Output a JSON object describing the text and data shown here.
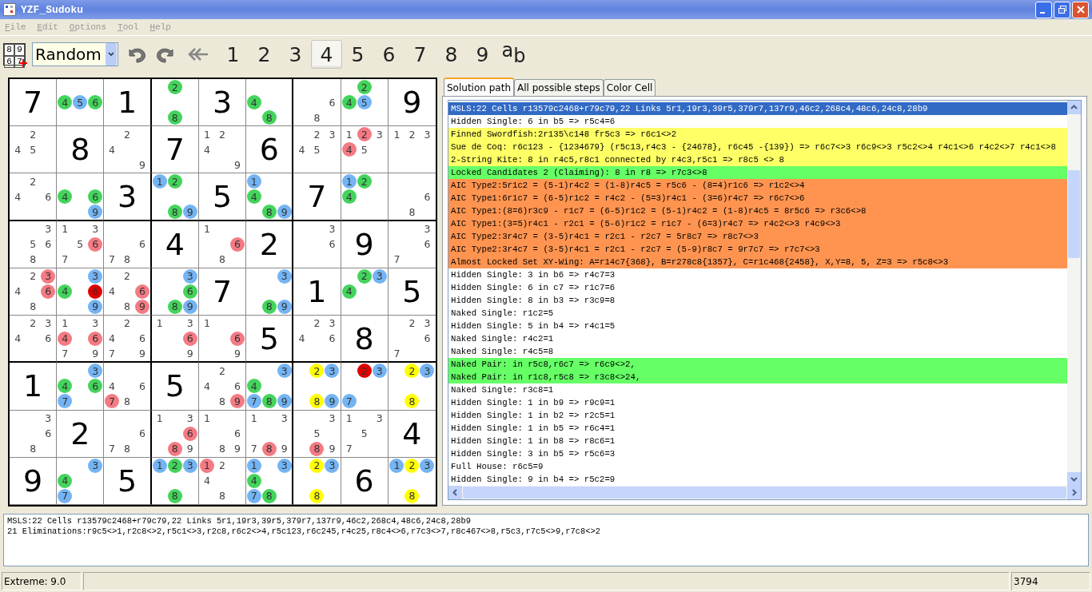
{
  "window": {
    "title": "YZF_Sudoku"
  },
  "menu": [
    "File",
    "Edit",
    "Options",
    "Tool",
    "Help"
  ],
  "toolbar": {
    "new_icon_digits": [
      "8",
      "9",
      "6",
      "7"
    ],
    "mode": "Random",
    "digits": [
      {
        "label": "1",
        "selected": false
      },
      {
        "label": "2",
        "selected": false
      },
      {
        "label": "3",
        "selected": false
      },
      {
        "label": "4",
        "selected": true
      },
      {
        "label": "5",
        "selected": false
      },
      {
        "label": "6",
        "selected": false
      },
      {
        "label": "7",
        "selected": false
      },
      {
        "label": "8",
        "selected": false
      },
      {
        "label": "9",
        "selected": false
      }
    ],
    "notation": {
      "upper": "a",
      "lower": "b"
    }
  },
  "board": {
    "rows": [
      [
        {
          "kind": "given",
          "value": "7"
        },
        {
          "kind": "candidates",
          "candidates": [
            {
              "digit": "4",
              "color": "#44d45c"
            },
            {
              "digit": "5",
              "color": "#74b4f4"
            },
            {
              "digit": "6",
              "color": "#44d45c"
            }
          ]
        },
        {
          "kind": "given",
          "value": "1"
        },
        {
          "kind": "candidates",
          "candidates": [
            {
              "digit": "2",
              "color": "#44d45c"
            },
            {
              "digit": "8",
              "color": "#44d45c"
            }
          ]
        },
        {
          "kind": "given",
          "value": "3"
        },
        {
          "kind": "candidates",
          "candidates": [
            {
              "digit": "4",
              "color": "#44d45c"
            },
            {
              "digit": "8",
              "color": "#44d45c"
            }
          ]
        },
        {
          "kind": "candidates",
          "candidates": [
            {
              "digit": "6"
            },
            {
              "digit": "8"
            }
          ]
        },
        {
          "kind": "candidates",
          "candidates": [
            {
              "digit": "2",
              "color": "#44d45c"
            },
            {
              "digit": "4",
              "color": "#44d45c"
            },
            {
              "digit": "5",
              "color": "#74b4f4"
            }
          ]
        },
        {
          "kind": "given",
          "value": "9"
        }
      ],
      [
        {
          "kind": "candidates",
          "candidates": [
            {
              "digit": "2"
            },
            {
              "digit": "4"
            },
            {
              "digit": "5"
            }
          ]
        },
        {
          "kind": "given",
          "value": "8"
        },
        {
          "kind": "candidates",
          "candidates": [
            {
              "digit": "2"
            },
            {
              "digit": "4"
            },
            {
              "digit": "9"
            }
          ]
        },
        {
          "kind": "given",
          "value": "7"
        },
        {
          "kind": "candidates",
          "candidates": [
            {
              "digit": "1"
            },
            {
              "digit": "2"
            },
            {
              "digit": "4"
            },
            {
              "digit": "9"
            }
          ]
        },
        {
          "kind": "given",
          "value": "6"
        },
        {
          "kind": "candidates",
          "candidates": [
            {
              "digit": "2"
            },
            {
              "digit": "3"
            },
            {
              "digit": "4"
            },
            {
              "digit": "5"
            }
          ]
        },
        {
          "kind": "candidates",
          "candidates": [
            {
              "digit": "1"
            },
            {
              "digit": "2",
              "color": "#f47a84"
            },
            {
              "digit": "3"
            },
            {
              "digit": "4",
              "color": "#f47a84"
            },
            {
              "digit": "5"
            }
          ]
        },
        {
          "kind": "candidates",
          "candidates": [
            {
              "digit": "1"
            },
            {
              "digit": "2"
            },
            {
              "digit": "3"
            }
          ]
        }
      ],
      [
        {
          "kind": "candidates",
          "candidates": [
            {
              "digit": "2"
            },
            {
              "digit": "4"
            },
            {
              "digit": "6"
            }
          ]
        },
        {
          "kind": "candidates",
          "candidates": [
            {
              "digit": "4",
              "color": "#44d45c"
            },
            {
              "digit": "6",
              "color": "#44d45c"
            },
            {
              "digit": "9",
              "color": "#74b4f4"
            }
          ]
        },
        {
          "kind": "given",
          "value": "3"
        },
        {
          "kind": "candidates",
          "candidates": [
            {
              "digit": "1",
              "color": "#74b4f4"
            },
            {
              "digit": "2",
              "color": "#44d45c"
            },
            {
              "digit": "8",
              "color": "#44d45c"
            },
            {
              "digit": "9",
              "color": "#74b4f4"
            }
          ]
        },
        {
          "kind": "given",
          "value": "5"
        },
        {
          "kind": "candidates",
          "candidates": [
            {
              "digit": "1",
              "color": "#74b4f4"
            },
            {
              "digit": "4",
              "color": "#44d45c"
            },
            {
              "digit": "8",
              "color": "#44d45c"
            },
            {
              "digit": "9",
              "color": "#74b4f4"
            }
          ]
        },
        {
          "kind": "given",
          "value": "7"
        },
        {
          "kind": "candidates",
          "candidates": [
            {
              "digit": "1",
              "color": "#74b4f4"
            },
            {
              "digit": "2",
              "color": "#44d45c"
            },
            {
              "digit": "4",
              "color": "#44d45c"
            }
          ]
        },
        {
          "kind": "candidates",
          "candidates": [
            {
              "digit": "6"
            },
            {
              "digit": "8"
            }
          ]
        }
      ],
      [
        {
          "kind": "candidates",
          "candidates": [
            {
              "digit": "3"
            },
            {
              "digit": "5"
            },
            {
              "digit": "6"
            },
            {
              "digit": "8"
            }
          ]
        },
        {
          "kind": "candidates",
          "candidates": [
            {
              "digit": "1"
            },
            {
              "digit": "3"
            },
            {
              "digit": "5"
            },
            {
              "digit": "6",
              "color": "#f47a84"
            },
            {
              "digit": "7"
            }
          ]
        },
        {
          "kind": "candidates",
          "candidates": [
            {
              "digit": "6"
            },
            {
              "digit": "7"
            },
            {
              "digit": "8"
            }
          ]
        },
        {
          "kind": "given",
          "value": "4"
        },
        {
          "kind": "candidates",
          "candidates": [
            {
              "digit": "1"
            },
            {
              "digit": "6",
              "color": "#f47a84"
            },
            {
              "digit": "8"
            }
          ]
        },
        {
          "kind": "given",
          "value": "2"
        },
        {
          "kind": "candidates",
          "candidates": [
            {
              "digit": "3"
            },
            {
              "digit": "6"
            }
          ]
        },
        {
          "kind": "given",
          "value": "9"
        },
        {
          "kind": "candidates",
          "candidates": [
            {
              "digit": "3"
            },
            {
              "digit": "6"
            },
            {
              "digit": "7"
            }
          ]
        }
      ],
      [
        {
          "kind": "candidates",
          "candidates": [
            {
              "digit": "2"
            },
            {
              "digit": "3",
              "color": "#f47a84"
            },
            {
              "digit": "4"
            },
            {
              "digit": "6",
              "color": "#f47a84"
            },
            {
              "digit": "8"
            }
          ]
        },
        {
          "kind": "candidates",
          "candidates": [
            {
              "digit": "3",
              "color": "#74b4f4"
            },
            {
              "digit": "4",
              "color": "#44d45c"
            },
            {
              "digit": "6",
              "color": "#e00000"
            },
            {
              "digit": "9",
              "color": "#74b4f4"
            }
          ]
        },
        {
          "kind": "candidates",
          "candidates": [
            {
              "digit": "2"
            },
            {
              "digit": "4"
            },
            {
              "digit": "6",
              "color": "#f47a84"
            },
            {
              "digit": "8"
            },
            {
              "digit": "9",
              "color": "#f47a84"
            }
          ]
        },
        {
          "kind": "candidates",
          "candidates": [
            {
              "digit": "3",
              "color": "#74b4f4"
            },
            {
              "digit": "6",
              "color": "#44d45c"
            },
            {
              "digit": "8",
              "color": "#44d45c"
            },
            {
              "digit": "9",
              "color": "#74b4f4"
            }
          ]
        },
        {
          "kind": "given",
          "value": "7"
        },
        {
          "kind": "candidates",
          "candidates": [
            {
              "digit": "3",
              "color": "#74b4f4"
            },
            {
              "digit": "8",
              "color": "#44d45c"
            },
            {
              "digit": "9",
              "color": "#74b4f4"
            }
          ]
        },
        {
          "kind": "given",
          "value": "1"
        },
        {
          "kind": "candidates",
          "candidates": [
            {
              "digit": "2",
              "color": "#44d45c"
            },
            {
              "digit": "3",
              "color": "#74b4f4"
            },
            {
              "digit": "4",
              "color": "#44d45c"
            }
          ]
        },
        {
          "kind": "given",
          "value": "5"
        }
      ],
      [
        {
          "kind": "candidates",
          "candidates": [
            {
              "digit": "2"
            },
            {
              "digit": "3"
            },
            {
              "digit": "4"
            },
            {
              "digit": "6"
            }
          ]
        },
        {
          "kind": "candidates",
          "candidates": [
            {
              "digit": "1"
            },
            {
              "digit": "3"
            },
            {
              "digit": "4",
              "color": "#f47a84"
            },
            {
              "digit": "6",
              "color": "#f47a84"
            },
            {
              "digit": "7"
            },
            {
              "digit": "9"
            }
          ]
        },
        {
          "kind": "candidates",
          "candidates": [
            {
              "digit": "2"
            },
            {
              "digit": "4"
            },
            {
              "digit": "6"
            },
            {
              "digit": "7"
            },
            {
              "digit": "9"
            }
          ]
        },
        {
          "kind": "candidates",
          "candidates": [
            {
              "digit": "1"
            },
            {
              "digit": "3"
            },
            {
              "digit": "6",
              "color": "#f47a84"
            },
            {
              "digit": "9"
            }
          ]
        },
        {
          "kind": "candidates",
          "candidates": [
            {
              "digit": "1"
            },
            {
              "digit": "6",
              "color": "#f47a84"
            },
            {
              "digit": "9"
            }
          ]
        },
        {
          "kind": "given",
          "value": "5"
        },
        {
          "kind": "candidates",
          "candidates": [
            {
              "digit": "2"
            },
            {
              "digit": "3"
            },
            {
              "digit": "4"
            },
            {
              "digit": "6"
            }
          ]
        },
        {
          "kind": "given",
          "value": "8"
        },
        {
          "kind": "candidates",
          "candidates": [
            {
              "digit": "2"
            },
            {
              "digit": "3"
            },
            {
              "digit": "6"
            },
            {
              "digit": "7"
            }
          ]
        }
      ],
      [
        {
          "kind": "given",
          "value": "1"
        },
        {
          "kind": "candidates",
          "candidates": [
            {
              "digit": "3",
              "color": "#74b4f4"
            },
            {
              "digit": "4",
              "color": "#44d45c"
            },
            {
              "digit": "6",
              "color": "#44d45c"
            },
            {
              "digit": "7",
              "color": "#74b4f4"
            }
          ]
        },
        {
          "kind": "candidates",
          "candidates": [
            {
              "digit": "4"
            },
            {
              "digit": "6"
            },
            {
              "digit": "7",
              "color": "#f47a84"
            },
            {
              "digit": "8"
            }
          ]
        },
        {
          "kind": "given",
          "value": "5"
        },
        {
          "kind": "candidates",
          "candidates": [
            {
              "digit": "2"
            },
            {
              "digit": "4"
            },
            {
              "digit": "6"
            },
            {
              "digit": "8"
            },
            {
              "digit": "9",
              "color": "#f47a84"
            }
          ]
        },
        {
          "kind": "candidates",
          "candidates": [
            {
              "digit": "3",
              "color": "#74b4f4"
            },
            {
              "digit": "4",
              "color": "#44d45c"
            },
            {
              "digit": "7",
              "color": "#74b4f4"
            },
            {
              "digit": "8",
              "color": "#44d45c"
            },
            {
              "digit": "9",
              "color": "#74b4f4"
            }
          ]
        },
        {
          "kind": "candidates",
          "candidates": [
            {
              "digit": "2",
              "color": "#ffff00"
            },
            {
              "digit": "3",
              "color": "#74b4f4"
            },
            {
              "digit": "8",
              "color": "#ffff00"
            },
            {
              "digit": "9",
              "color": "#74b4f4"
            }
          ]
        },
        {
          "kind": "candidates",
          "candidates": [
            {
              "digit": "2",
              "color": "#e00000"
            },
            {
              "digit": "3",
              "color": "#74b4f4"
            },
            {
              "digit": "7",
              "color": "#74b4f4"
            }
          ]
        },
        {
          "kind": "candidates",
          "candidates": [
            {
              "digit": "2",
              "color": "#ffff00"
            },
            {
              "digit": "3",
              "color": "#74b4f4"
            },
            {
              "digit": "8",
              "color": "#ffff00"
            }
          ]
        }
      ],
      [
        {
          "kind": "candidates",
          "candidates": [
            {
              "digit": "3"
            },
            {
              "digit": "6"
            },
            {
              "digit": "8"
            }
          ]
        },
        {
          "kind": "given",
          "value": "2"
        },
        {
          "kind": "candidates",
          "candidates": [
            {
              "digit": "6"
            },
            {
              "digit": "7"
            },
            {
              "digit": "8"
            }
          ]
        },
        {
          "kind": "candidates",
          "candidates": [
            {
              "digit": "1"
            },
            {
              "digit": "3"
            },
            {
              "digit": "6",
              "color": "#f47a84"
            },
            {
              "digit": "8",
              "color": "#f47a84"
            },
            {
              "digit": "9"
            }
          ]
        },
        {
          "kind": "candidates",
          "candidates": [
            {
              "digit": "1"
            },
            {
              "digit": "6"
            },
            {
              "digit": "8"
            },
            {
              "digit": "9"
            }
          ]
        },
        {
          "kind": "candidates",
          "candidates": [
            {
              "digit": "1"
            },
            {
              "digit": "3"
            },
            {
              "digit": "7"
            },
            {
              "digit": "8",
              "color": "#f47a84"
            },
            {
              "digit": "9"
            }
          ]
        },
        {
          "kind": "candidates",
          "candidates": [
            {
              "digit": "3"
            },
            {
              "digit": "5"
            },
            {
              "digit": "8",
              "color": "#f47a84"
            },
            {
              "digit": "9"
            }
          ]
        },
        {
          "kind": "candidates",
          "candidates": [
            {
              "digit": "1"
            },
            {
              "digit": "3"
            },
            {
              "digit": "5"
            },
            {
              "digit": "7"
            }
          ]
        },
        {
          "kind": "given",
          "value": "4"
        }
      ],
      [
        {
          "kind": "given",
          "value": "9"
        },
        {
          "kind": "candidates",
          "candidates": [
            {
              "digit": "3",
              "color": "#74b4f4"
            },
            {
              "digit": "4",
              "color": "#44d45c"
            },
            {
              "digit": "7",
              "color": "#74b4f4"
            }
          ]
        },
        {
          "kind": "given",
          "value": "5"
        },
        {
          "kind": "candidates",
          "candidates": [
            {
              "digit": "1",
              "color": "#74b4f4"
            },
            {
              "digit": "2",
              "color": "#44d45c"
            },
            {
              "digit": "3",
              "color": "#74b4f4"
            },
            {
              "digit": "8",
              "color": "#44d45c"
            }
          ]
        },
        {
          "kind": "candidates",
          "candidates": [
            {
              "digit": "1",
              "color": "#f47a84"
            },
            {
              "digit": "2"
            },
            {
              "digit": "4"
            },
            {
              "digit": "8"
            }
          ]
        },
        {
          "kind": "candidates",
          "candidates": [
            {
              "digit": "1",
              "color": "#74b4f4"
            },
            {
              "digit": "3",
              "color": "#74b4f4"
            },
            {
              "digit": "4",
              "color": "#44d45c"
            },
            {
              "digit": "7",
              "color": "#74b4f4"
            },
            {
              "digit": "8",
              "color": "#44d45c"
            }
          ]
        },
        {
          "kind": "candidates",
          "candidates": [
            {
              "digit": "2",
              "color": "#ffff00"
            },
            {
              "digit": "3",
              "color": "#74b4f4"
            },
            {
              "digit": "8",
              "color": "#ffff00"
            }
          ]
        },
        {
          "kind": "given",
          "value": "6"
        },
        {
          "kind": "candidates",
          "candidates": [
            {
              "digit": "1",
              "color": "#74b4f4"
            },
            {
              "digit": "2",
              "color": "#ffff00"
            },
            {
              "digit": "3",
              "color": "#74b4f4"
            },
            {
              "digit": "8",
              "color": "#ffff00"
            }
          ]
        }
      ]
    ]
  },
  "tabs": [
    {
      "label": "Solution path",
      "selected": true
    },
    {
      "label": "All possible steps",
      "selected": false
    },
    {
      "label": "Color Cell",
      "selected": false
    }
  ],
  "steps": [
    {
      "text": "MSLS:22 Cells r13579c2468+r79c79,22 Links 5r1,19r3,39r5,379r7,137r9,46c2,268c4,48c6,24c8,28b9",
      "selected": true
    },
    {
      "text": "Hidden Single: 6 in b5 => r5c4=6",
      "selected": false
    },
    {
      "text": "Finned Swordfish:2r135\\c148 fr5c3 => r6c1<>2",
      "selected": false,
      "color": "#ffff66"
    },
    {
      "text": "Sue de Coq: r6c123 - {1234679} (r5c13,r4c3 - {24678}, r6c45 -{139}) =>  r6c7<>3 r6c9<>3 r5c2<>4 r4c1<>6 r4c2<>7 r4c1<>8",
      "selected": false,
      "color": "#ffff66"
    },
    {
      "text": "2-String Kite: 8 in r4c5,r8c1 connected by r4c3,r5c1 => r8c5 <> 8",
      "selected": false,
      "color": "#ffff66"
    },
    {
      "text": "Locked Candidates 2 (Claiming): 8 in r8 => r7c3<>8",
      "selected": false,
      "color": "#66ff66"
    },
    {
      "text": "AIC Type2:5r1c2 = (5-1)r4c2 = (1-8)r4c5 = r5c6 - (8=4)r1c6 => r1c2<>4",
      "selected": false,
      "color": "#ff9450"
    },
    {
      "text": "AIC Type1:6r1c7 = (6-5)r1c2 = r4c2 - (5=3)r4c1 - (3=6)r4c7 => r6c7<>6",
      "selected": false,
      "color": "#ff9450"
    },
    {
      "text": "AIC Type1:(8=6)r3c9 - r1c7 = (6-5)r1c2 = (5-1)r4c2 = (1-8)r4c5 = 8r5c6 => r3c6<>8",
      "selected": false,
      "color": "#ff9450"
    },
    {
      "text": "AIC Type1:(3=5)r4c1 - r2c1 = (5-6)r1c2 = r1c7 - (6=3)r4c7 => r4c2<>3 r4c9<>3",
      "selected": false,
      "color": "#ff9450"
    },
    {
      "text": "AIC Type2:3r4c7 = (3-5)r4c1 = r2c1 - r2c7 = 5r8c7 => r8c7<>3",
      "selected": false,
      "color": "#ff9450"
    },
    {
      "text": "AIC Type2:3r4c7 = (3-5)r4c1 = r2c1 - r2c7 = (5-9)r8c7 = 9r7c7 => r7c7<>3",
      "selected": false,
      "color": "#ff9450"
    },
    {
      "text": "Almost Locked Set XY-Wing: A=r14c7{368}, B=r278c8{1357}, C=r1c468{2458}, X,Y=8, 5, Z=3 =>  r5c8<>3",
      "selected": false,
      "color": "#ff9450"
    },
    {
      "text": "Hidden Single: 3 in b6 => r4c7=3",
      "selected": false
    },
    {
      "text": "Hidden Single: 6 in c7 => r1c7=6",
      "selected": false
    },
    {
      "text": "Hidden Single: 8 in b3 => r3c9=8",
      "selected": false
    },
    {
      "text": "Naked Single: r1c2=5",
      "selected": false
    },
    {
      "text": "Hidden Single: 5 in b4 => r4c1=5",
      "selected": false
    },
    {
      "text": "Naked Single: r4c2=1",
      "selected": false
    },
    {
      "text": "Naked Single: r4c5=8",
      "selected": false
    },
    {
      "text": "Naked Pair: in r5c8,r6c7 => r6c9<>2,",
      "selected": false,
      "color": "#66ff66"
    },
    {
      "text": "Naked Pair: in r1c8,r5c8 => r3c8<>24,",
      "selected": false,
      "color": "#66ff66"
    },
    {
      "text": "Naked Single: r3c8=1",
      "selected": false
    },
    {
      "text": "Hidden Single: 1 in b9 => r9c9=1",
      "selected": false
    },
    {
      "text": "Hidden Single: 1 in b2 => r2c5=1",
      "selected": false
    },
    {
      "text": "Hidden Single: 1 in b5 => r6c4=1",
      "selected": false
    },
    {
      "text": "Hidden Single: 1 in b8 => r8c6=1",
      "selected": false
    },
    {
      "text": "Hidden Single: 3 in b5 => r5c6=3",
      "selected": false
    },
    {
      "text": "Full House: r6c5=9",
      "selected": false
    },
    {
      "text": "Hidden Single: 9 in b4 => r5c2=9",
      "selected": false
    }
  ],
  "details": [
    "MSLS:22 Cells r13579c2468+r79c79,22 Links 5r1,19r3,39r5,379r7,137r9,46c2,268c4,48c6,24c8,28b9",
    "21 Eliminations:r9c5<>1,r2c8<>2,r5c1<>3,r2c8,r6c2<>4,r5c123,r6c245,r4c25,r8c4<>6,r7c3<>7,r8c467<>8,r5c3,r7c5<>9,r7c8<>2"
  ],
  "status_bar": {
    "difficulty": "Extreme: 9.0",
    "count": "3794"
  }
}
